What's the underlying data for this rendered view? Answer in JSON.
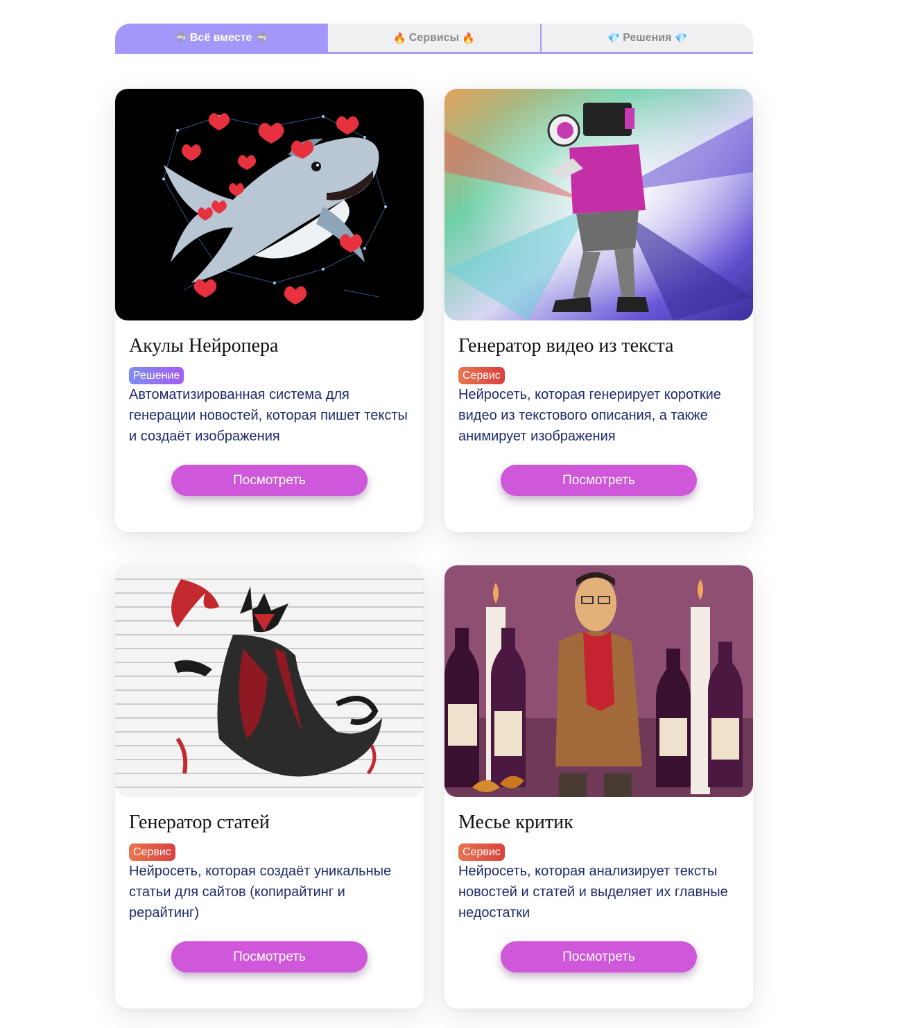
{
  "tabs": [
    {
      "label": "Всё вместе",
      "icon": "shark-icon",
      "emoji": "🦈",
      "active": true
    },
    {
      "label": "Сервисы",
      "icon": "fire-icon",
      "emoji": "🔥",
      "active": false
    },
    {
      "label": "Решения",
      "icon": "diamond-icon",
      "emoji": "💎",
      "active": false
    }
  ],
  "cards": [
    {
      "title": "Акулы Нейропера",
      "badge": "Решение",
      "description": "Автоматизированная система для генерации новостей, которая пишет тексты и создаёт изображения",
      "button": "Посмотреть"
    },
    {
      "title": "Генератор видео из текста",
      "badge": "Сервис",
      "description": "Нейросеть, которая генерирует короткие видео из текстового описания, а также анимирует изображения",
      "button": "Посмотреть"
    },
    {
      "title": "Генератор статей",
      "badge": "Сервис",
      "description": "Нейросеть, которая создаёт уникальные статьи для сайтов (копирайтинг и рерайтинг)",
      "button": "Посмотреть"
    },
    {
      "title": "Месье критик",
      "badge": "Сервис",
      "description": "Нейросеть, которая анализирует тексты новостей и статей и выделяет их главные недостатки",
      "button": "Посмотреть"
    }
  ],
  "colors": {
    "tab_active": "#a397fb",
    "button": "#cf57d9",
    "badge_solution": "#8f74f1",
    "badge_service": "#e05a48",
    "description_text": "#1e2a6b"
  }
}
